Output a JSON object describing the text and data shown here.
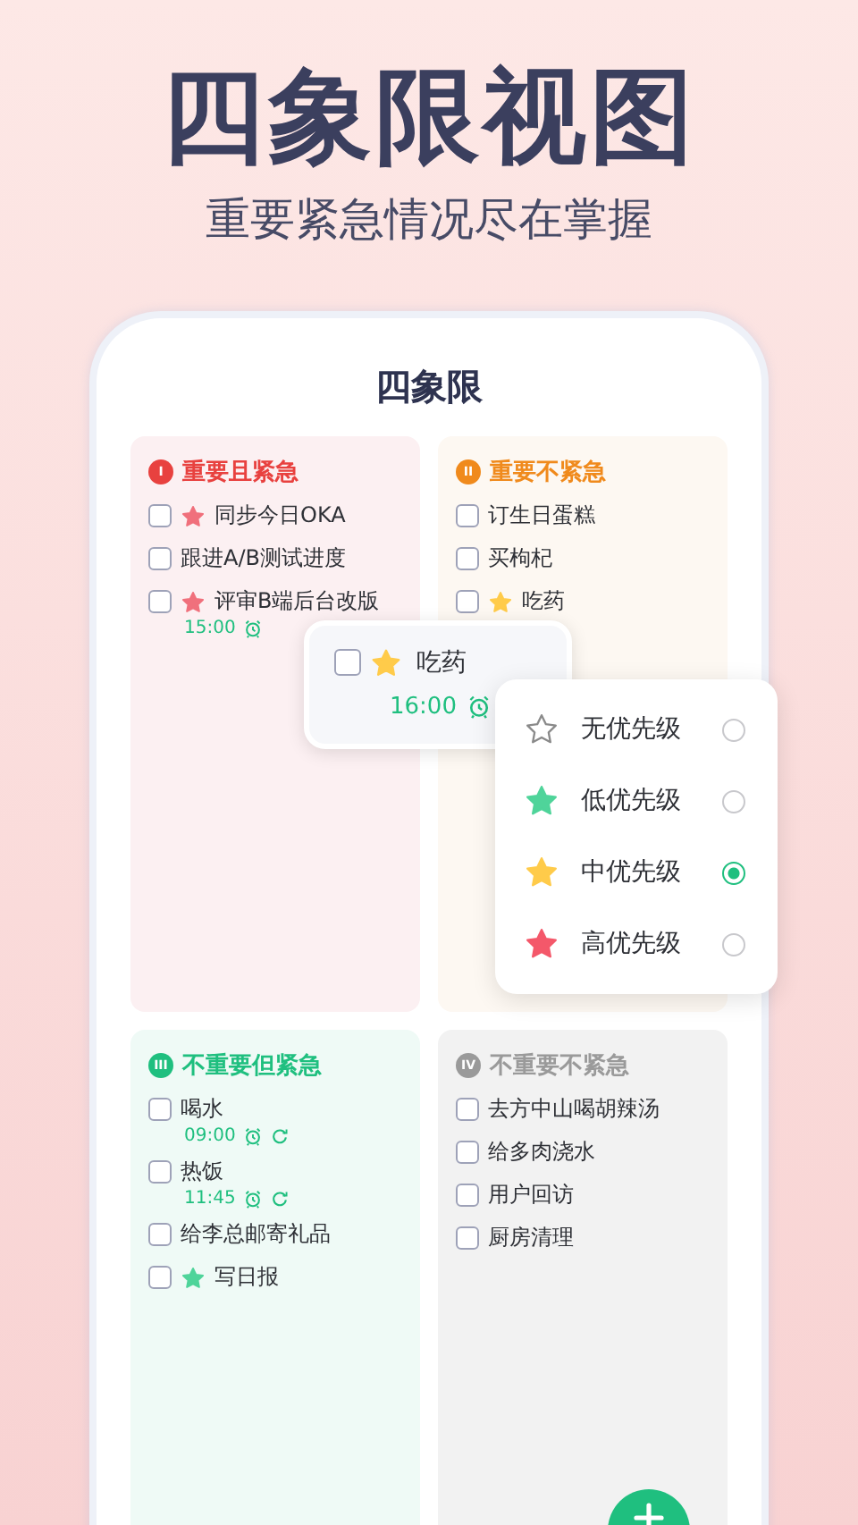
{
  "headline": "四象限视图",
  "subtitle": "重要紧急情况尽在掌握",
  "screen_title": "四象限",
  "quadrants": [
    {
      "badge": "I",
      "title": "重要且紧急",
      "color": "#e8413f",
      "items": [
        {
          "text": "同步今日OKA",
          "checked": false,
          "star": {
            "color": "#f0707c"
          }
        },
        {
          "text": "跟进A/B测试进度",
          "checked": false
        },
        {
          "text": "评审B端后台改版",
          "checked": false,
          "star": {
            "color": "#f0707c"
          },
          "time": "15:00",
          "alarm": true
        }
      ]
    },
    {
      "badge": "II",
      "title": "重要不紧急",
      "color": "#f08a1c",
      "items": [
        {
          "text": "订生日蛋糕",
          "checked": false
        },
        {
          "text": "买枸杞",
          "checked": false
        },
        {
          "text": "吃药",
          "checked": false,
          "star": {
            "color": "#ffcb4a"
          }
        }
      ]
    },
    {
      "badge": "III",
      "title": "不重要但紧急",
      "color": "#1fbf7f",
      "items": [
        {
          "text": "喝水",
          "checked": false,
          "time": "09:00",
          "alarm": true,
          "repeat": true
        },
        {
          "text": "热饭",
          "checked": false,
          "time": "11:45",
          "alarm": true,
          "repeat": true
        },
        {
          "text": "给李总邮寄礼品",
          "checked": false
        },
        {
          "text": "写日报",
          "checked": false,
          "star": {
            "color": "#4fd49a"
          }
        }
      ]
    },
    {
      "badge": "IV",
      "title": "不重要不紧急",
      "color": "#9a9a9a",
      "items": [
        {
          "text": "去方中山喝胡辣汤",
          "checked": false
        },
        {
          "text": "给多肉浇水",
          "checked": false
        },
        {
          "text": "用户回访",
          "checked": false
        },
        {
          "text": "厨房清理",
          "checked": false
        }
      ]
    }
  ],
  "dragged_task": {
    "text": "吃药",
    "checked": false,
    "star": {
      "color": "#ffcb4a"
    },
    "time": "16:00",
    "alarm": true
  },
  "priority_menu": [
    {
      "label": "无优先级",
      "color": "#8a8a8a",
      "filled": false,
      "selected": false
    },
    {
      "label": "低优先级",
      "color": "#4fd49a",
      "filled": true,
      "selected": false
    },
    {
      "label": "中优先级",
      "color": "#ffcb4a",
      "filled": true,
      "selected": true
    },
    {
      "label": "高优先级",
      "color": "#f4586a",
      "filled": true,
      "selected": false
    }
  ]
}
